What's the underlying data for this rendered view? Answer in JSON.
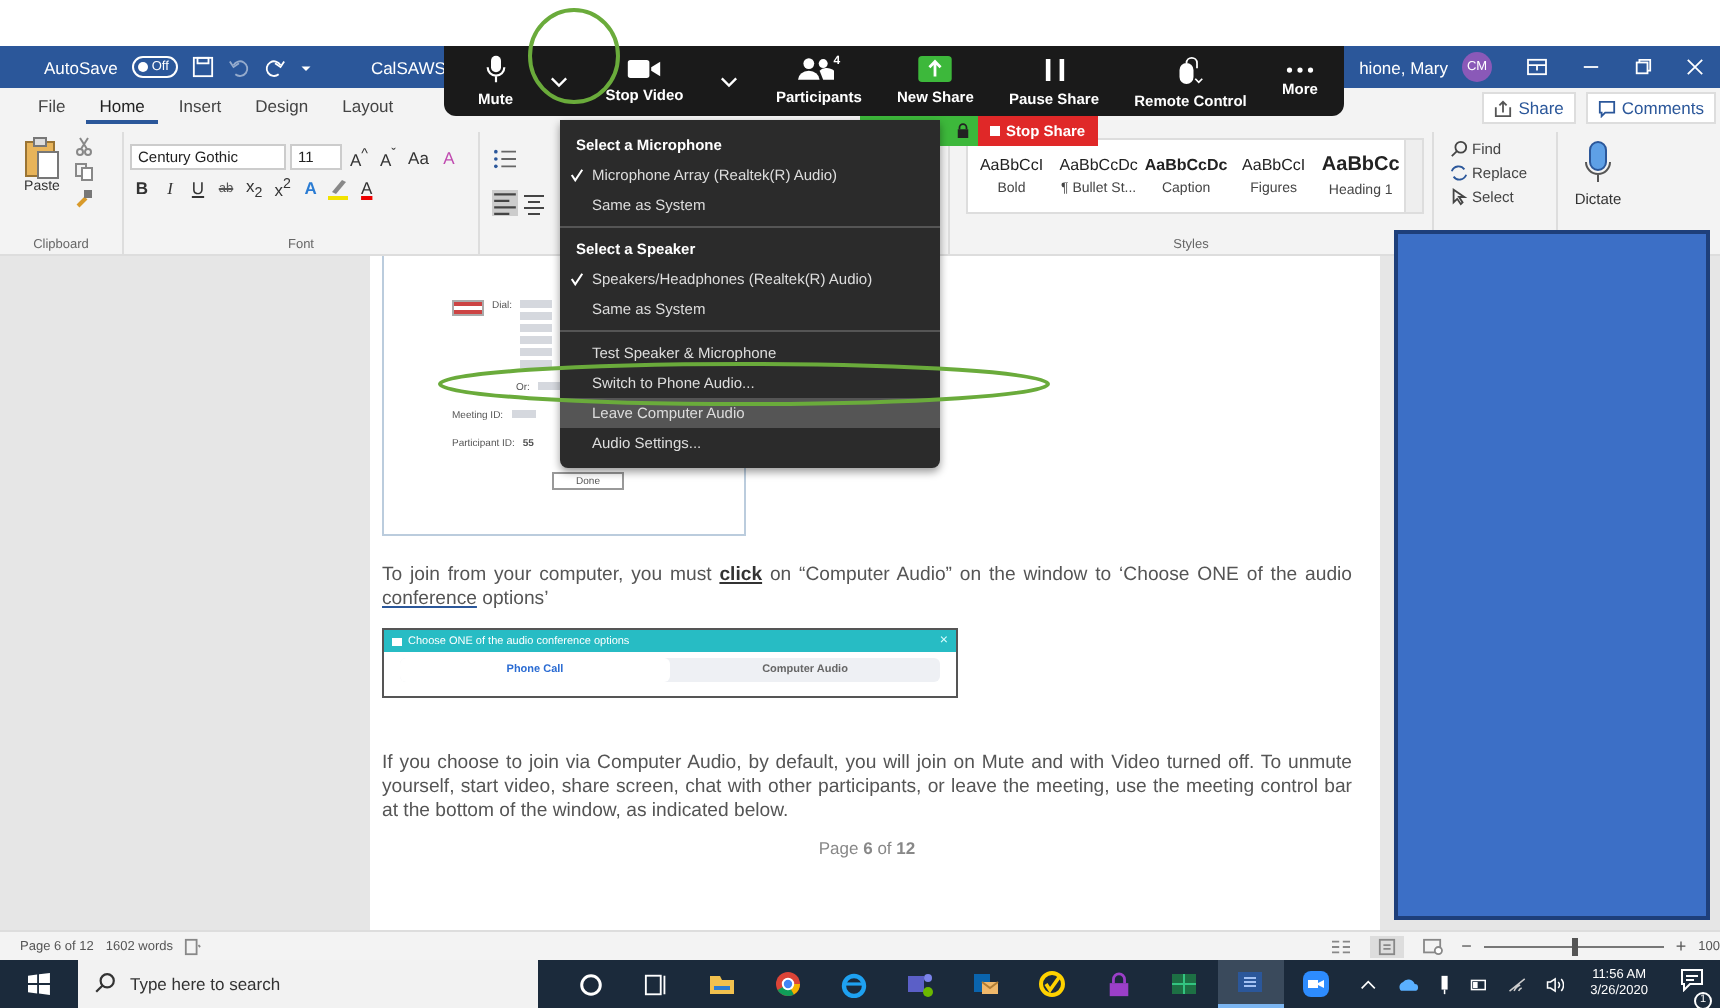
{
  "title_bar": {
    "autosave_label": "AutoSave",
    "autosave_state": "Off",
    "autosave_on": false,
    "document_title": "CalSAWS",
    "user_name": "hione, Mary",
    "avatar_initials": "CM"
  },
  "ribbon_tabs": [
    {
      "label": "File",
      "selected": false
    },
    {
      "label": "Home",
      "selected": true
    },
    {
      "label": "Insert",
      "selected": false
    },
    {
      "label": "Design",
      "selected": false
    },
    {
      "label": "Layout",
      "selected": false
    }
  ],
  "ribbon_buttons": [
    "Share",
    "Comments"
  ],
  "clipboard": {
    "paste": "Paste",
    "label": "Clipboard"
  },
  "font": {
    "family": "Century Gothic",
    "size": "11",
    "grow": "A$^{^}$",
    "shrink": "A$^{ˇ}$",
    "change_case": "Aa",
    "clear": "A",
    "bold": "B",
    "italic": "I",
    "underline": "U",
    "strike": "ab",
    "subscript": "x$_{2}$",
    "superscript": "x$^{2}$",
    "effects": "A",
    "text_color": "A",
    "label": "Font"
  },
  "styles": {
    "items": [
      {
        "preview": "AaBbCcI",
        "name": "Bold",
        "kind": "plain"
      },
      {
        "preview": "AaBbCcDc",
        "name": "¶ Bullet St...",
        "kind": "plain"
      },
      {
        "preview": "AaBbCcDc",
        "name": "Caption",
        "kind": "strong"
      },
      {
        "preview": "AaBbCcI",
        "name": "Figures",
        "kind": "plain"
      },
      {
        "preview": "AaBbCc",
        "name": "Heading 1",
        "kind": "heading"
      }
    ],
    "label": "Styles"
  },
  "editing": {
    "find": "Find",
    "replace": "Replace",
    "select": "Select",
    "dictate": "Dictate"
  },
  "meeting_toolbar": [
    {
      "kind": "mic",
      "label": "Mute"
    },
    {
      "kind": "caret"
    },
    {
      "kind": "video",
      "label": "Stop Video"
    },
    {
      "kind": "caret"
    },
    {
      "kind": "people",
      "label": "Participants",
      "count": "4"
    },
    {
      "kind": "share",
      "label": "New Share"
    },
    {
      "kind": "pause",
      "label": "Pause Share"
    },
    {
      "kind": "mouse",
      "label": "Remote Control"
    },
    {
      "kind": "dots",
      "label": "More"
    }
  ],
  "share_bar": {
    "stop_label": "Stop Share"
  },
  "audio_menu": [
    {
      "kind": "heading",
      "label": "Select a Microphone"
    },
    {
      "kind": "option",
      "label": "Microphone Array (Realtek(R) Audio)",
      "checked": true
    },
    {
      "kind": "option",
      "label": "Same as System",
      "checked": false
    },
    {
      "kind": "divider"
    },
    {
      "kind": "heading",
      "label": "Select a Speaker"
    },
    {
      "kind": "option",
      "label": "Speakers/Headphones (Realtek(R) Audio)",
      "checked": true
    },
    {
      "kind": "option",
      "label": "Same as System",
      "checked": false
    },
    {
      "kind": "divider"
    },
    {
      "kind": "action",
      "label": "Test Speaker & Microphone",
      "selected": false
    },
    {
      "kind": "action",
      "label": "Switch to Phone Audio...",
      "selected": false
    },
    {
      "kind": "action",
      "label": "Leave Computer Audio",
      "selected": true
    },
    {
      "kind": "action",
      "label": "Audio Settings...",
      "selected": false
    }
  ],
  "dial_dialog": {
    "dial_label": "Dial:",
    "or_label": "Or:",
    "meeting_id_label": "Meeting ID:",
    "participant_id_label": "Participant ID:",
    "participant_id": "55",
    "done_button": "Done"
  },
  "paragraph_1": [
    {
      "kind": "plain",
      "text": "To join from your computer, you must "
    },
    {
      "kind": "strong",
      "text": "click"
    },
    {
      "kind": "plain",
      "text": " on “Computer Audio” on the window to ‘Choose ONE of the audio "
    },
    {
      "kind": "underlined",
      "text": "conference"
    },
    {
      "kind": "plain",
      "text": " options’"
    }
  ],
  "audio_dialog": {
    "title": "Choose ONE of the audio conference options",
    "close": "×",
    "tabs": [
      {
        "label": "Phone Call",
        "selected": true
      },
      {
        "label": "Computer Audio",
        "selected": false
      }
    ]
  },
  "paragraph_2": "If you choose to join via Computer Audio, by default, you will join on Mute and with Video turned off.  To unmute yourself, start video, share screen, chat with other participants, or leave the meeting, use the meeting control bar at the bottom of the window, as indicated below.",
  "page_footer": "Page **6** of **12**",
  "status_bar": {
    "page": "Page 6 of 12",
    "words": "1602 words",
    "zoom_out": "−",
    "zoom_in": "+",
    "zoom": "100",
    "level": 0.5
  },
  "taskbar": {
    "search_placeholder": "Type here to search",
    "apps": [
      {
        "kind": "ring",
        "selected": false
      },
      {
        "kind": "tasks",
        "selected": false
      },
      {
        "kind": "folder",
        "selected": false
      },
      {
        "kind": "wheel",
        "selected": false
      },
      {
        "kind": "swoosh",
        "selected": false
      },
      {
        "kind": "team",
        "selected": false
      },
      {
        "kind": "mail",
        "selected": false
      },
      {
        "kind": "check",
        "selected": false
      },
      {
        "kind": "lock",
        "selected": false
      },
      {
        "kind": "sheet",
        "selected": false
      },
      {
        "kind": "doc",
        "selected": true
      },
      {
        "kind": "camera",
        "selected": false
      }
    ],
    "time": "11:56 AM",
    "date": "3/26/2020",
    "notifications": "1"
  }
}
